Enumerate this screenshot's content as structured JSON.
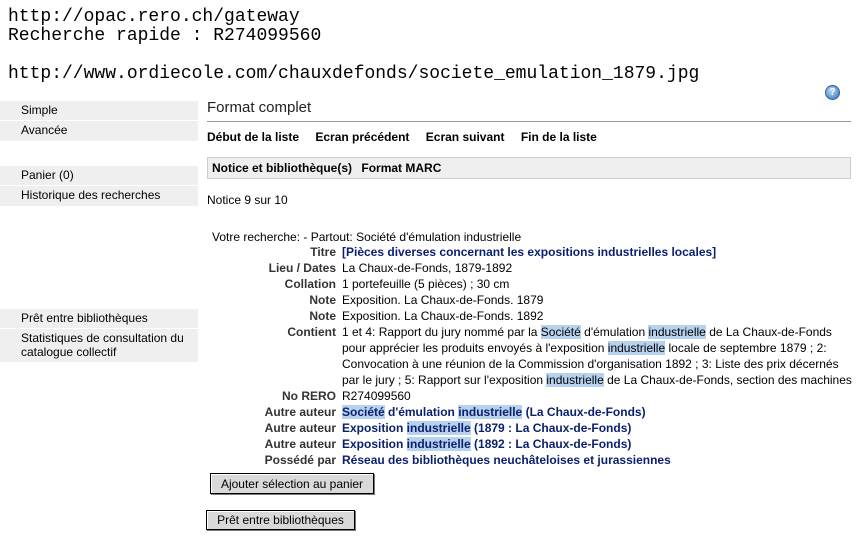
{
  "header": {
    "url1": "http://opac.rero.ch/gateway",
    "quick_search": "Recherche rapide : R274099560",
    "url2": "http://www.ordiecole.com/chauxdefonds/societe_emulation_1879.jpg"
  },
  "sidebar": {
    "group1": [
      "Simple",
      "Avancée"
    ],
    "group2": [
      "Panier (0)",
      "Historique des recherches"
    ],
    "group3": [
      "Prêt entre bibliothèques",
      "Statistiques de consultation du catalogue collectif"
    ]
  },
  "page_title": "Format complet",
  "nav": [
    "Début de la liste",
    "Ecran précédent",
    "Ecran suivant",
    "Fin de la liste"
  ],
  "tabs": [
    "Notice et bibliothèque(s)",
    "Format MARC"
  ],
  "count": "Notice 9 sur 10",
  "search_label": "Votre recherche: - Partout: Société d'émulation industrielle",
  "record": {
    "titre_label": "Titre",
    "titre": "[Pièces diverses concernant les expositions industrielles locales]",
    "lieu_label": "Lieu / Dates",
    "lieu": "La Chaux-de-Fonds, 1879-1892",
    "collation_label": "Collation",
    "collation": "1 portefeuille (5 pièces) ; 30 cm",
    "note_label": "Note",
    "note1": "Exposition. La Chaux-de-Fonds. 1879",
    "note2": "Exposition. La Chaux-de-Fonds. 1892",
    "contient_label": "Contient",
    "contient_parts": [
      "1 et 4: Rapport du jury nommé par la ",
      "Société",
      " d'émulation ",
      "industrielle",
      " de La Chaux-de-Fonds pour apprécier les produits envoyés à l'exposition ",
      "industrielle",
      " locale de septembre 1879 ; 2: Convocation à une réunion de la Commission d'organisation 1892 ; 3: Liste des prix décernés par le jury ; 5: Rapport sur l'exposition ",
      "industrielle",
      " de La Chaux-de-Fonds, section des machines"
    ],
    "norero_label": "No RERO",
    "norero": "R274099560",
    "auteur_label": "Autre auteur",
    "auteur1_parts": [
      "Société",
      " d'émulation ",
      "industrielle",
      " (La Chaux-de-Fonds)"
    ],
    "auteur2_parts": [
      "Exposition ",
      "industrielle",
      " (1879 : La Chaux-de-Fonds)"
    ],
    "auteur3_parts": [
      "Exposition ",
      "industrielle",
      " (1892 : La Chaux-de-Fonds)"
    ],
    "possede_label": "Possédé par",
    "possede": "Réseau des bibliothèques neuchâteloises et jurassiennes"
  },
  "buttons": {
    "add": "Ajouter sélection au panier",
    "ill": "Prêt entre bibliothèques"
  },
  "help_icon": "?",
  "colors": {
    "highlight": "#b6d2ee",
    "link": "#0a1f6e",
    "sidebar_bg": "#efefef"
  }
}
